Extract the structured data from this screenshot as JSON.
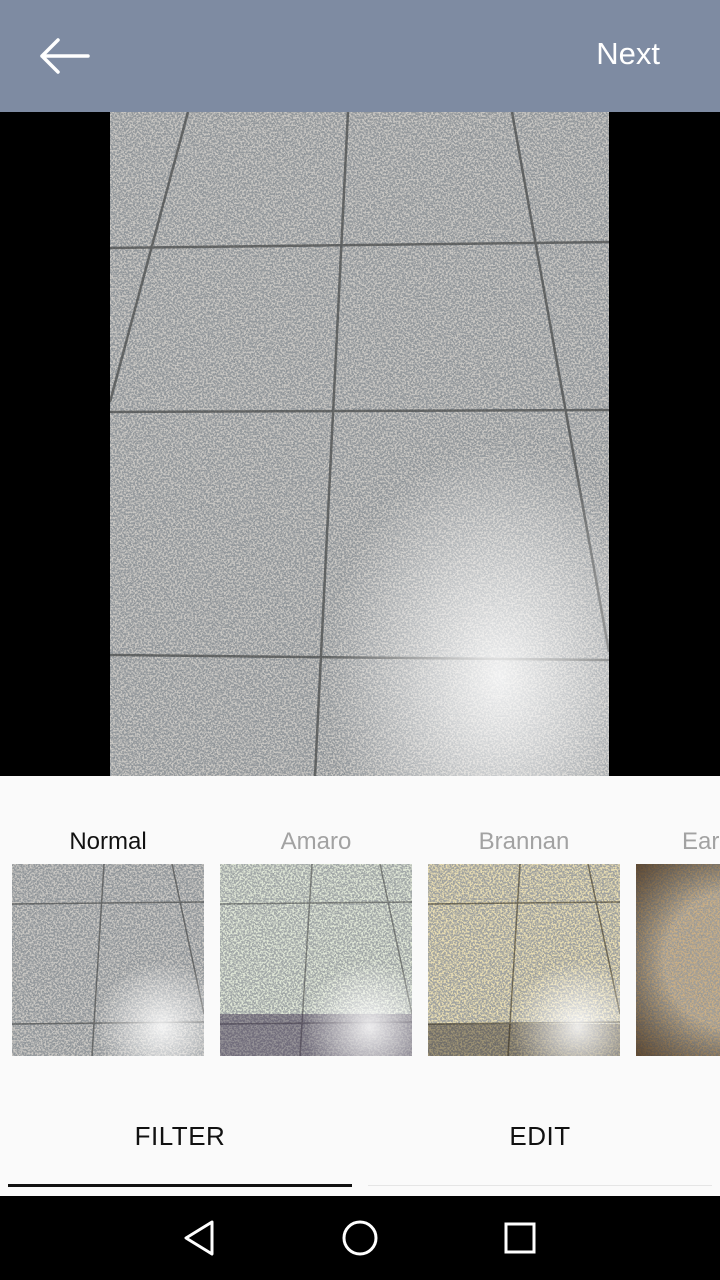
{
  "header": {
    "back_icon": "arrow-left-icon",
    "next_label": "Next"
  },
  "filters": [
    {
      "label": "Normal",
      "selected": true,
      "tint": "#ffffff"
    },
    {
      "label": "Amaro",
      "selected": false,
      "tint": "#dfe8d8"
    },
    {
      "label": "Brannan",
      "selected": false,
      "tint": "#efe2b8"
    },
    {
      "label": "Ear",
      "selected": false,
      "tint": "#cdb390"
    }
  ],
  "tabs": {
    "filter_label": "FILTER",
    "edit_label": "EDIT",
    "active": "FILTER"
  },
  "navbar": {
    "back_icon": "nav-back-triangle-icon",
    "home_icon": "nav-home-circle-icon",
    "recents_icon": "nav-recents-square-icon"
  },
  "colors": {
    "top_bar": "#7e8ba2",
    "active_text": "#111111",
    "inactive_text": "#a2a2a2"
  }
}
